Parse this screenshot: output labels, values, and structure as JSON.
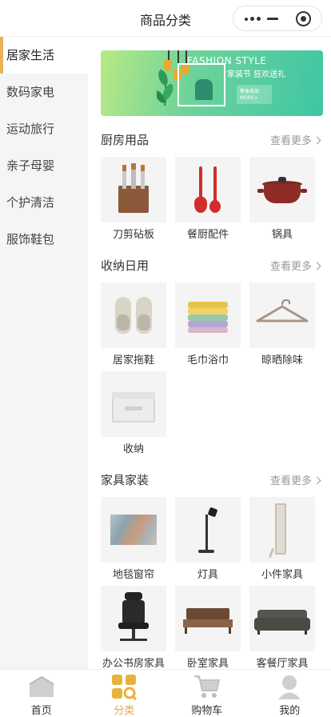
{
  "header": {
    "title": "商品分类"
  },
  "sidebar": {
    "items": [
      {
        "label": "居家生活",
        "active": true
      },
      {
        "label": "数码家电",
        "active": false
      },
      {
        "label": "运动旅行",
        "active": false
      },
      {
        "label": "亲子母婴",
        "active": false
      },
      {
        "label": "个护清洁",
        "active": false
      },
      {
        "label": "服饰鞋包",
        "active": false
      }
    ]
  },
  "banner": {
    "headline": "FASHION STYLE",
    "subhead": "家装节 狂欢送礼",
    "cta_line1": "筹备商品",
    "cta_line2": "MORE>"
  },
  "sections": [
    {
      "title": "厨房用品",
      "more": "查看更多",
      "items": [
        {
          "label": "刀剪砧板",
          "icon": "knife-set-icon"
        },
        {
          "label": "餐厨配件",
          "icon": "kitchen-utensils-icon"
        },
        {
          "label": "锅具",
          "icon": "pot-icon"
        }
      ]
    },
    {
      "title": "收纳日用",
      "more": "查看更多",
      "items": [
        {
          "label": "居家拖鞋",
          "icon": "slippers-icon"
        },
        {
          "label": "毛巾浴巾",
          "icon": "towels-icon"
        },
        {
          "label": "晾晒除味",
          "icon": "hanger-icon"
        },
        {
          "label": "收纳",
          "icon": "storage-box-icon"
        }
      ]
    },
    {
      "title": "家具家装",
      "more": "查看更多",
      "items": [
        {
          "label": "地毯窗帘",
          "icon": "rug-icon"
        },
        {
          "label": "灯具",
          "icon": "lamp-icon"
        },
        {
          "label": "小件家具",
          "icon": "mirror-icon"
        },
        {
          "label": "办公书房家具",
          "icon": "office-chair-icon"
        },
        {
          "label": "卧室家具",
          "icon": "bed-icon"
        },
        {
          "label": "客餐厅家具",
          "icon": "sofa-icon"
        }
      ]
    }
  ],
  "tabbar": {
    "items": [
      {
        "label": "首页",
        "icon": "home-icon",
        "active": false
      },
      {
        "label": "分类",
        "icon": "category-icon",
        "active": true
      },
      {
        "label": "购物车",
        "icon": "cart-icon",
        "active": false
      },
      {
        "label": "我的",
        "icon": "profile-icon",
        "active": false
      }
    ]
  },
  "colors": {
    "accent": "#e6b25a",
    "active_tab": "#e6a934",
    "sidebar_bg": "#f5f5f5"
  }
}
